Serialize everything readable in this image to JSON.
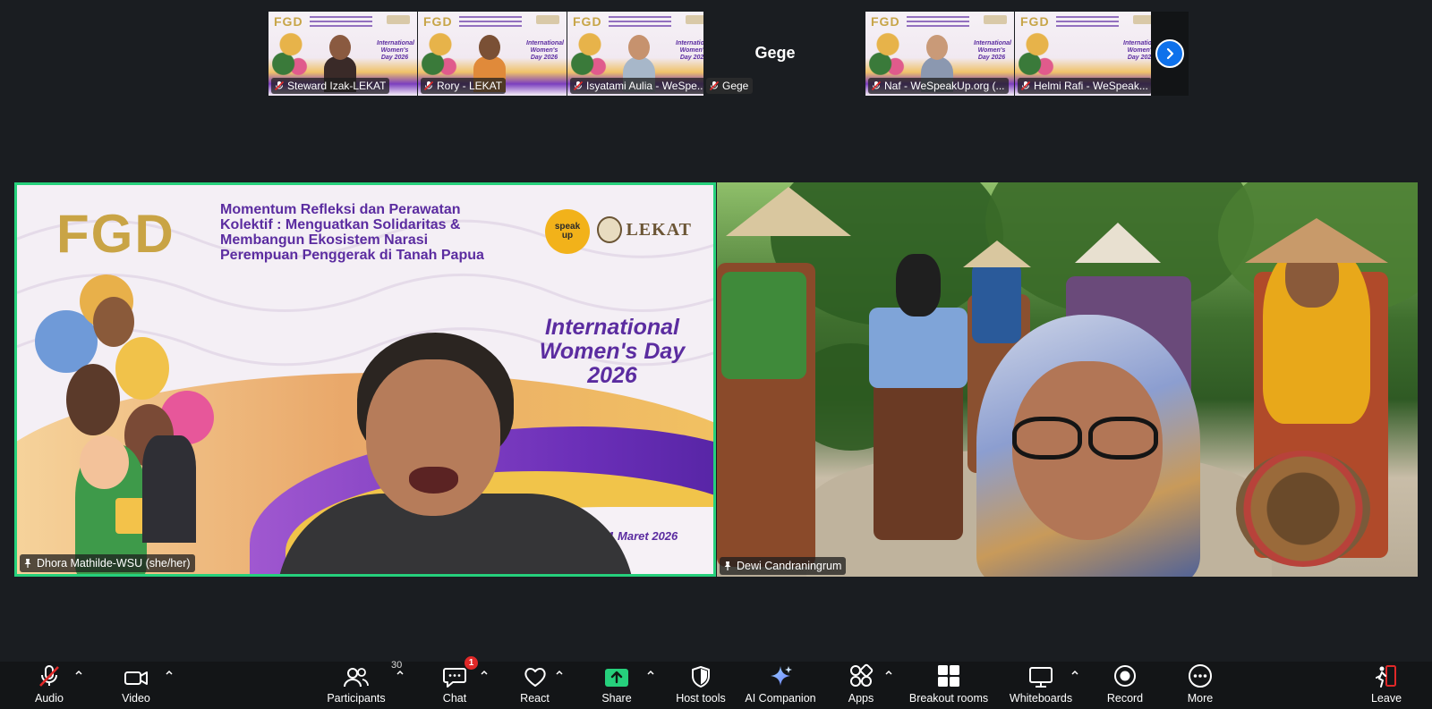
{
  "thumbnails": [
    {
      "name": "Steward Izak-LEKAT"
    },
    {
      "name": "Rory - LEKAT"
    },
    {
      "name": "Isyatami Aulia - WeSpe..."
    },
    {
      "name": "Naf - WeSpeakUp.org (..."
    },
    {
      "name": "Helmi Rafi - WeSpeak..."
    }
  ],
  "audio_only_tile": {
    "display_name": "Gege",
    "tag": "Gege"
  },
  "thumb_slide": {
    "fgd": "FGD",
    "iwd": "International Women's Day 2026"
  },
  "main_left": {
    "participant": "Dhora Mathilde-WSU (she/her)",
    "slide": {
      "fgd": "FGD",
      "title_lines": [
        "Momentum Refleksi dan Perawatan",
        "Kolektif : Menguatkan Solidaritas &",
        "Membangun Ekosistem Narasi",
        "Perempuan Penggerak di Tanah Papua"
      ],
      "logo_speak": [
        "speak",
        "up"
      ],
      "logo_lekat": "LEKAT",
      "iwd_lines": [
        "International",
        "Women's Day",
        "2026"
      ],
      "date": "...bu, 11 Maret 2026"
    }
  },
  "main_right": {
    "participant": "Dewi Candraningrum"
  },
  "toolbar": {
    "audio": "Audio",
    "video": "Video",
    "participants": "Participants",
    "participants_count": "30",
    "chat": "Chat",
    "chat_badge": "1",
    "react": "React",
    "share": "Share",
    "host_tools": "Host tools",
    "ai_companion": "AI Companion",
    "apps": "Apps",
    "breakout_rooms": "Breakout rooms",
    "whiteboards": "Whiteboards",
    "record": "Record",
    "more": "More",
    "leave": "Leave"
  },
  "colors": {
    "active_speaker_border": "#26d07c",
    "share_green": "#26d07c",
    "next_button_blue": "#0e71eb",
    "mute_red": "#e02828",
    "background": "#1a1d21",
    "slide_purple": "#5b2ca0",
    "slide_gold": "#c9a445"
  }
}
